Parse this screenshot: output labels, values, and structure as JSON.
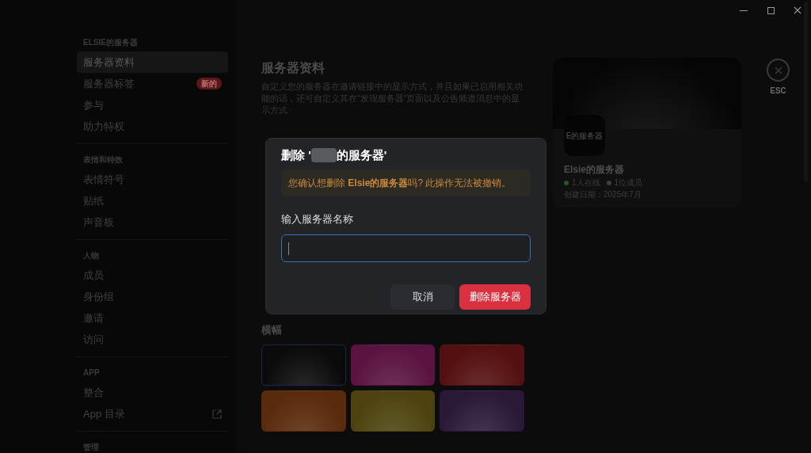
{
  "sidebar": {
    "sections": [
      {
        "heading": "ELSIE的服务器",
        "items": [
          {
            "label": "服务器资料",
            "selected": true
          },
          {
            "label": "服务器标签",
            "selected": false,
            "badge": "新的"
          },
          {
            "label": "参与",
            "selected": false
          },
          {
            "label": "助力特权",
            "selected": false
          }
        ]
      },
      {
        "heading": "表情和特效",
        "items": [
          {
            "label": "表情符号",
            "selected": false
          },
          {
            "label": "贴纸",
            "selected": false
          },
          {
            "label": "声音板",
            "selected": false
          }
        ]
      },
      {
        "heading": "人物",
        "items": [
          {
            "label": "成员",
            "selected": false
          },
          {
            "label": "身份组",
            "selected": false
          },
          {
            "label": "邀请",
            "selected": false
          },
          {
            "label": "访问",
            "selected": false
          }
        ]
      },
      {
        "heading": "APP",
        "items": [
          {
            "label": "整合",
            "selected": false
          },
          {
            "label": "App 目录",
            "selected": false,
            "external": true
          }
        ]
      },
      {
        "heading": "管理"
      }
    ]
  },
  "main": {
    "title": "服务器资料",
    "description": "自定义您的服务器在邀请链接中的显示方式，并且如果已启用相关功能的话，还可自定义其在“发现服务器”页面以及公告频道消息中的显示方式",
    "banner_label": "横幅",
    "banners": [
      {
        "color": "#0a0a0a",
        "selected": true
      },
      {
        "color": "#5a1340",
        "selected": false
      },
      {
        "color": "#541010",
        "selected": false
      },
      {
        "color": "#5a2a0c",
        "selected": false
      },
      {
        "color": "#4d430f",
        "selected": false
      },
      {
        "color": "#2a1838",
        "selected": false
      }
    ]
  },
  "preview": {
    "icon_text": "E的服务器",
    "name": "Elsie的服务器",
    "online": "1人在线",
    "members": "1位成员",
    "created": "创建日期：2025年7月"
  },
  "close": {
    "label": "ESC"
  },
  "dialog": {
    "title_prefix": "删除 '",
    "title_suffix": "的服务器'",
    "warning": "您确认想删除 **Elsie的服务器**吗? 此操作无法被撤销。",
    "field_label": "输入服务器名称",
    "cancel": "取消",
    "confirm": "删除服务器"
  }
}
